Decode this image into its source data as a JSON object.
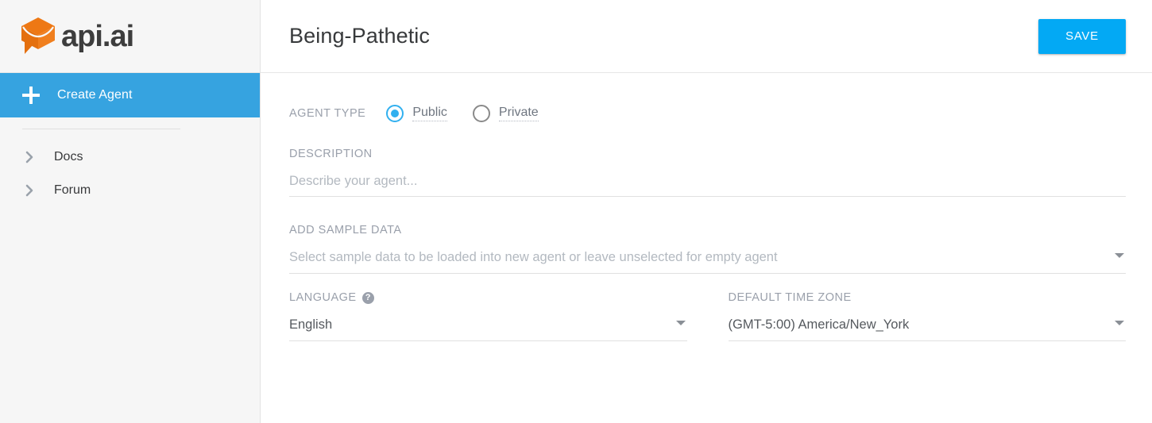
{
  "sidebar": {
    "logo": {
      "mark_icon": "api-ai-cube-logo-icon",
      "text": "api.ai",
      "orange": "#ec7211"
    },
    "create_agent": {
      "label": "Create Agent",
      "icon": "plus-icon",
      "active_color": "#36a3e0"
    },
    "items": [
      {
        "label": "Docs",
        "icon": "chevron-right-icon"
      },
      {
        "label": "Forum",
        "icon": "chevron-right-icon"
      }
    ]
  },
  "topbar": {
    "title": "Being-Pathetic",
    "save_label": "SAVE",
    "save_color": "#03a9f4"
  },
  "form": {
    "agent_type": {
      "label": "AGENT TYPE",
      "options": [
        {
          "label": "Public",
          "selected": true
        },
        {
          "label": "Private",
          "selected": false
        }
      ],
      "selected": "Public",
      "accent": "#31b0ef"
    },
    "description": {
      "label": "DESCRIPTION",
      "value": "",
      "placeholder": "Describe your agent..."
    },
    "sample_data": {
      "label": "ADD SAMPLE DATA",
      "value": "",
      "placeholder": "Select sample data to be loaded into new agent or leave unselected for empty agent",
      "caret_icon": "chevron-down-icon"
    },
    "language": {
      "label": "LANGUAGE",
      "help_icon": "help-circle-icon",
      "help_glyph": "?",
      "value": "English",
      "caret_icon": "chevron-down-icon"
    },
    "timezone": {
      "label": "DEFAULT TIME ZONE",
      "value": "(GMT-5:00) America/New_York",
      "caret_icon": "chevron-down-icon"
    }
  }
}
